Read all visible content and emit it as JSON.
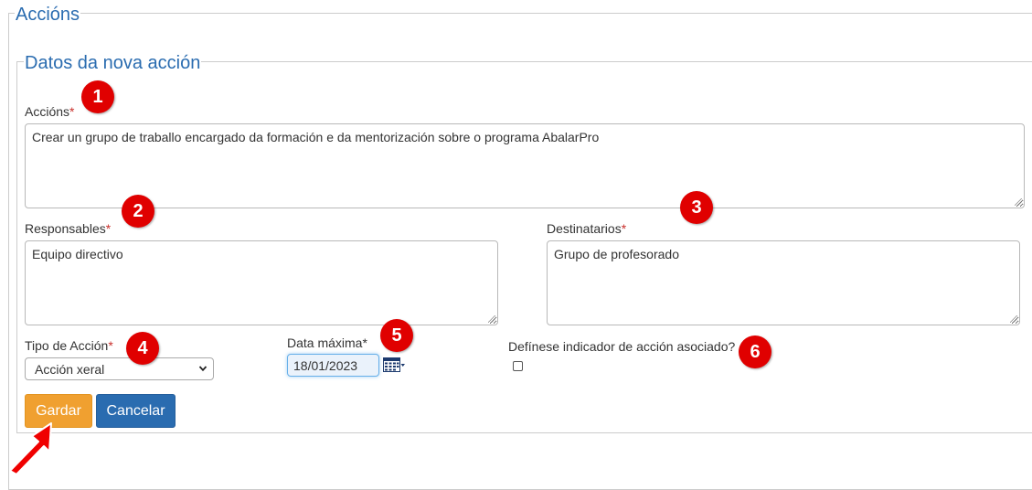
{
  "outer_legend": "Accións",
  "inner_legend": "Datos da nova acción",
  "required_mark": "*",
  "fields": {
    "accions": {
      "label": "Accións",
      "value": "Crear un grupo de traballo encargado da formación e da mentorización sobre o programa AbalarPro"
    },
    "responsables": {
      "label": "Responsables",
      "value": "Equipo directivo"
    },
    "destinatarios": {
      "label": "Destinatarios",
      "value": "Grupo de profesorado"
    },
    "tipo_accion": {
      "label": "Tipo de Acción",
      "selected": "Acción xeral"
    },
    "data_maxima": {
      "label": "Data máxima",
      "value": "18/01/2023"
    },
    "indicador": {
      "label": "Defínese indicador de acción asociado?",
      "checked": false
    }
  },
  "buttons": {
    "save": "Gardar",
    "cancel": "Cancelar"
  },
  "annotations": [
    "1",
    "2",
    "3",
    "4",
    "5",
    "6"
  ],
  "colors": {
    "accent": "#2a6cb0",
    "save_button": "#f0a030",
    "cancel_button": "#2a6cb0",
    "badge": "#e00000",
    "required": "#c9302c"
  },
  "icons": {
    "calendar": "calendar-icon",
    "select_arrow": "chevron-down-icon",
    "pointer": "red-arrow-icon"
  }
}
